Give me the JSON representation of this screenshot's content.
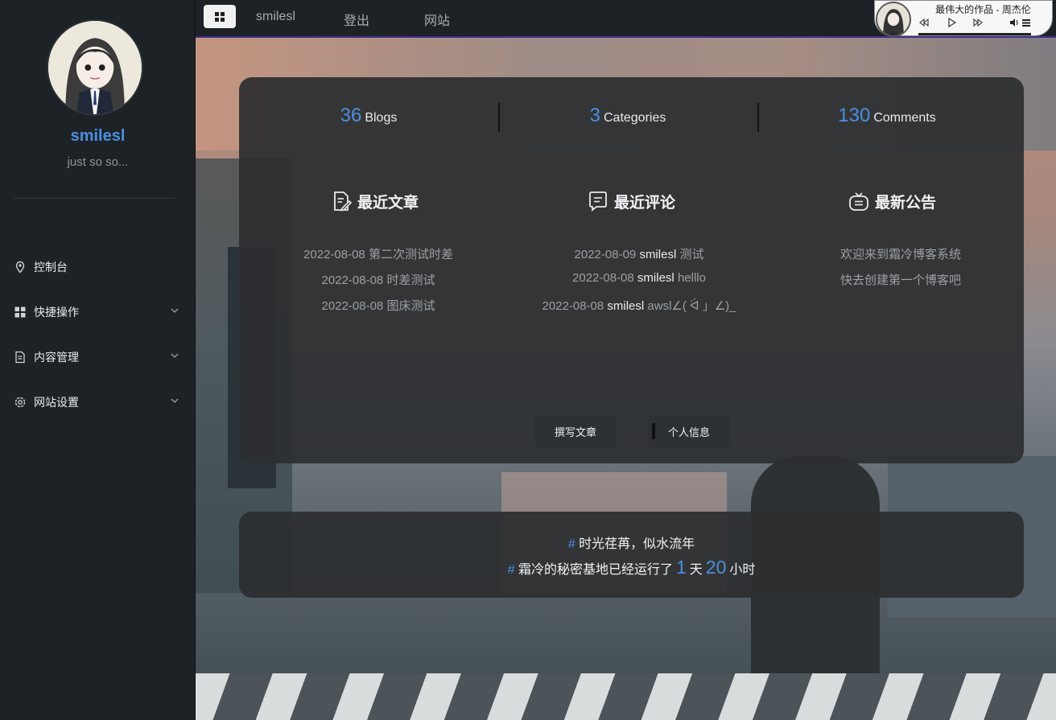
{
  "sidebar": {
    "user_name": "smilesl",
    "motto": "just so so...",
    "menu": [
      {
        "label": "控制台",
        "icon": "location-pin-icon",
        "has_children": false
      },
      {
        "label": "快捷操作",
        "icon": "grid-icon",
        "has_children": true
      },
      {
        "label": "内容管理",
        "icon": "document-icon",
        "has_children": true
      },
      {
        "label": "网站设置",
        "icon": "gear-icon",
        "has_children": true
      }
    ]
  },
  "topbar": {
    "toggle_icon": "grid-icon",
    "links": [
      "smilesl",
      "登出",
      "网站"
    ]
  },
  "player": {
    "song": "最伟大的作品 - 周杰伦",
    "controls": [
      "rewind-icon",
      "play-icon",
      "fast-forward-icon",
      "volume-icon",
      "playlist-icon"
    ]
  },
  "stats": [
    {
      "value": "36",
      "label": "Blogs"
    },
    {
      "value": "3",
      "label": "Categories"
    },
    {
      "value": "130",
      "label": "Comments"
    }
  ],
  "columns": {
    "recent_posts": {
      "title": "最近文章",
      "items": [
        "2022-08-08 第二次测试时差",
        "2022-08-08 时差测试",
        "2022-08-08 图床测试"
      ]
    },
    "recent_comments": {
      "title": "最近评论",
      "items": [
        {
          "date": "2022-08-09",
          "user": "smilesl",
          "text": "测试"
        },
        {
          "date": "2022-08-08",
          "user": "smilesl",
          "text": "helllo"
        },
        {
          "date": "2022-08-08",
          "user": "smilesl",
          "text": "awsl∠( ᐛ 」∠)_"
        }
      ]
    },
    "announcements": {
      "title": "最新公告",
      "items": [
        "欢迎来到霜冷博客系统",
        "快去创建第一个博客吧"
      ]
    }
  },
  "actions": {
    "write_label": "撰写文章",
    "profile_label": "个人信息"
  },
  "footer": {
    "hash": "#",
    "line1": "时光荏苒，似水流年",
    "line2_prefix": "霜冷的秘密基地已经运行了",
    "days": "1",
    "days_unit": "天",
    "hours": "20",
    "hours_unit": "小时"
  },
  "colors": {
    "accent": "#4a8fe0",
    "sidebar_bg": "#1d2227",
    "panel_bg": "#2c2e30"
  }
}
